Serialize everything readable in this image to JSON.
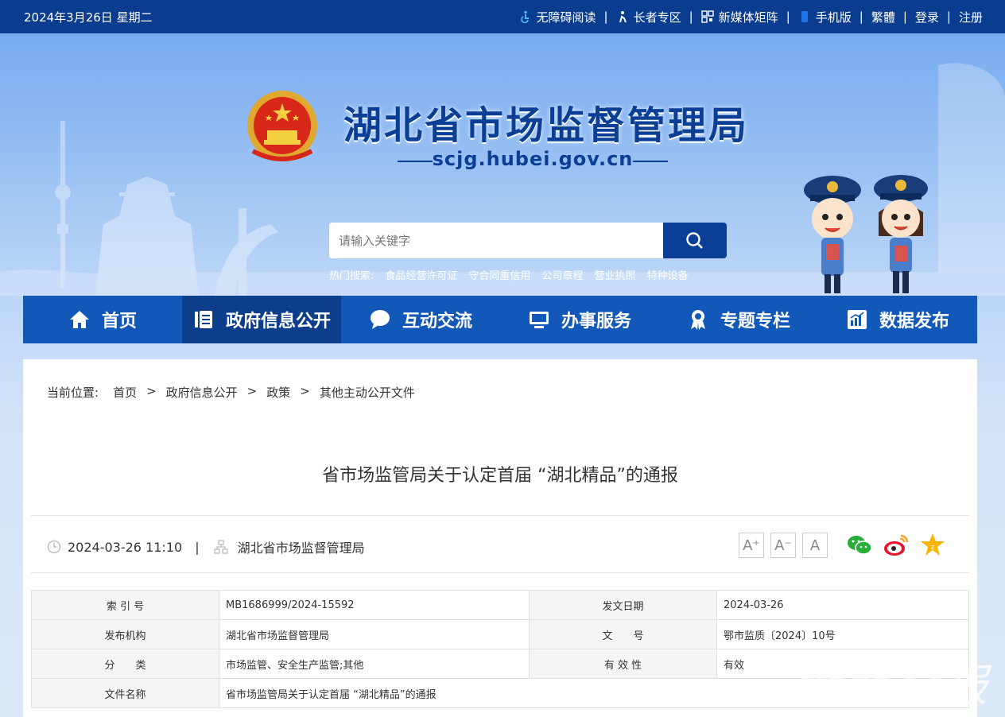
{
  "topbar": {
    "date": "2024年3月26日 星期二",
    "links": [
      {
        "label": "无障碍阅读",
        "icon": "wheelchair-icon"
      },
      {
        "label": "长者专区",
        "icon": "elder-icon"
      },
      {
        "label": "新媒体矩阵",
        "icon": "grid-icon"
      },
      {
        "label": "手机版",
        "icon": "phone-icon"
      },
      {
        "label": "繁體"
      },
      {
        "label": "登录"
      },
      {
        "label": "注册"
      }
    ],
    "separator": "|"
  },
  "header": {
    "title": "湖北省市场监督管理局",
    "url": "scjg.hubei.gov.cn",
    "search_placeholder": "请输入关键字",
    "hot_label": "热门搜索:",
    "hot_items": [
      "食品经营许可证",
      "守合同重信用",
      "公司章程",
      "营业执照",
      "特种设备"
    ]
  },
  "nav": {
    "items": [
      {
        "label": "首页",
        "icon": "home-icon"
      },
      {
        "label": "政府信息公开",
        "icon": "document-list-icon",
        "active": true
      },
      {
        "label": "互动交流",
        "icon": "chat-bubble-icon"
      },
      {
        "label": "办事服务",
        "icon": "monitor-icon"
      },
      {
        "label": "专题专栏",
        "icon": "award-ribbon-icon"
      },
      {
        "label": "数据发布",
        "icon": "bar-chart-icon"
      }
    ]
  },
  "breadcrumb": {
    "prefix": "当前位置:",
    "items": [
      "首页",
      "政府信息公开",
      "政策",
      "其他主动公开文件"
    ],
    "arrow": ">"
  },
  "article": {
    "title": "省市场监管局关于认定首届 “湖北精品”的通报",
    "datetime": "2024-03-26 11:10",
    "meta_sep": "|",
    "publisher": "湖北省市场监督管理局",
    "font_buttons": [
      "A⁺",
      "A⁻",
      "A"
    ]
  },
  "info_table": {
    "rows": [
      [
        "索 引 号",
        "MB1686999/2024-15592",
        "发文日期",
        "2024-03-26"
      ],
      [
        "发布机构",
        "湖北省市场监督管理局",
        "文　　号",
        "鄂市监质〔2024〕10号"
      ],
      [
        "分　　类",
        "市场监管、安全生产监管;其他",
        "有 效 性",
        "有效"
      ],
      [
        "文件名称",
        "省市场监管局关于认定首届 “湖北精品”的通报"
      ]
    ]
  },
  "watermark": "湖北日报",
  "colors": {
    "topbar": "#0a3d8f",
    "nav": "#1258b8",
    "nav_active": "#0c3e8c",
    "title": "#0b3f96"
  }
}
